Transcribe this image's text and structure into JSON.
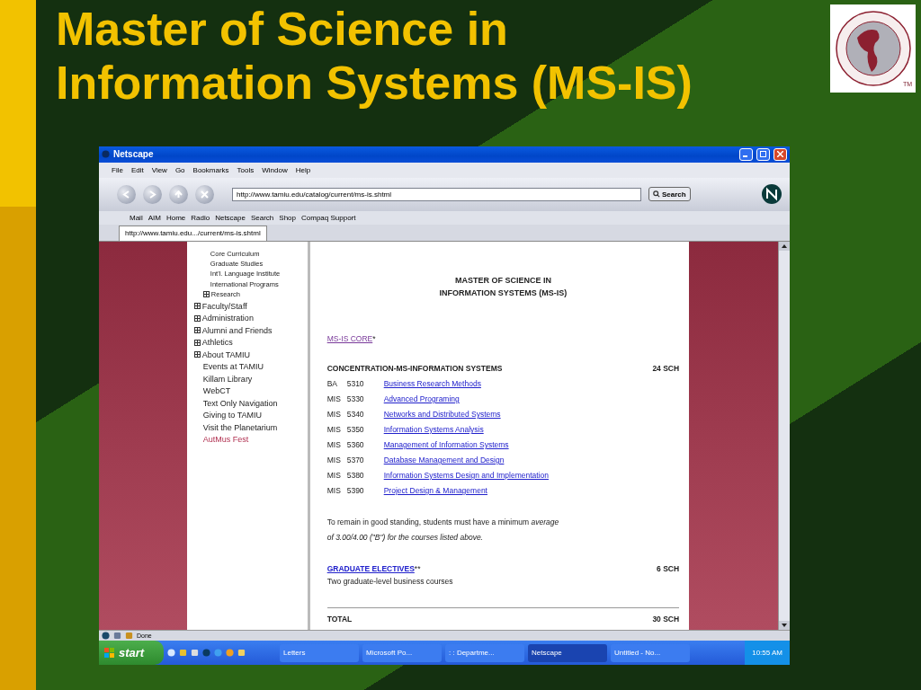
{
  "slide": {
    "title": [
      "Master of Science in",
      "Information Systems (MS-IS)"
    ],
    "logo": {
      "trademark": "TM"
    }
  },
  "browser": {
    "title": "Netscape",
    "menu": [
      "File",
      "Edit",
      "View",
      "Go",
      "Bookmarks",
      "Tools",
      "Window",
      "Help"
    ],
    "address": "http://www.tamiu.edu/catalog/current/ms-is.shtml",
    "search_button": "Search",
    "personal_toolbar": [
      "Mail",
      "AIM",
      "Home",
      "Radio",
      "Netscape",
      "Search",
      "Shop",
      "Compaq Support"
    ],
    "tab": {
      "label": "http://www.tamiu.edu.../current/ms-is.shtml",
      "selected": true
    },
    "nav": [
      {
        "kind": "sub",
        "label": "Core Curriculum"
      },
      {
        "kind": "sub",
        "label": "Graduate Studies"
      },
      {
        "kind": "sub",
        "label": "Int'l. Language Institute"
      },
      {
        "kind": "sub",
        "label": "International Programs"
      },
      {
        "kind": "subgroup",
        "label": "Research",
        "expanded": false
      },
      {
        "kind": "group",
        "label": "Faculty/Staff",
        "expanded": false
      },
      {
        "kind": "group",
        "label": "Administration",
        "expanded": false
      },
      {
        "kind": "group",
        "label": "Alumni and Friends",
        "expanded": false
      },
      {
        "kind": "group",
        "label": "Athletics",
        "expanded": false
      },
      {
        "kind": "group",
        "label": "About TAMIU",
        "expanded": false
      },
      {
        "kind": "link",
        "label": "Events at TAMIU",
        "visited": false
      },
      {
        "kind": "link",
        "label": "Killam Library",
        "visited": false
      },
      {
        "kind": "link",
        "label": "WebCT",
        "visited": false
      },
      {
        "kind": "link",
        "label": "Text Only Navigation",
        "visited": false
      },
      {
        "kind": "link",
        "label": "Giving to TAMIU",
        "visited": false
      },
      {
        "kind": "link",
        "label": "Visit the Planetarium",
        "visited": false
      },
      {
        "kind": "link",
        "label": "AutMus Fest",
        "visited": true
      }
    ],
    "page": {
      "heading": [
        "MASTER OF SCIENCE IN",
        "INFORMATION SYSTEMS (MS-IS)"
      ],
      "core": {
        "link": "MS-IS CORE",
        "suffix": "*"
      },
      "concentration": {
        "title": "CONCENTRATION-MS-INFORMATION SYSTEMS",
        "credits": "24 SCH"
      },
      "courses": [
        {
          "prefix": "BA",
          "number": "5310",
          "title": "Business Research Methods"
        },
        {
          "prefix": "MIS",
          "number": "5330",
          "title": "Advanced Programing"
        },
        {
          "prefix": "MIS",
          "number": "5340",
          "title": "Networks and Distributed Systems"
        },
        {
          "prefix": "MIS",
          "number": "5350",
          "title": "Information Systems Analysis"
        },
        {
          "prefix": "MIS",
          "number": "5360",
          "title": "Management of Information Systems"
        },
        {
          "prefix": "MIS",
          "number": "5370",
          "title": "Database Management and Design"
        },
        {
          "prefix": "MIS",
          "number": "5380",
          "title": "Information Systems Design and Implementation"
        },
        {
          "prefix": "MIS",
          "number": "5390",
          "title": "Project Design & Management"
        }
      ],
      "note": [
        "To remain in good standing, students must have a minimum *average*",
        "*of 3.00/4.00 (\"B\") for the courses listed above.*"
      ],
      "electives": {
        "link": "GRADUATE ELECTIVES",
        "suffix": "**",
        "credits": "6 SCH",
        "description": "Two graduate-level business courses"
      },
      "total": {
        "label": "TOTAL",
        "credits": "30 SCH"
      }
    },
    "status": "Done"
  },
  "taskbar": {
    "start": "start",
    "tasks": [
      {
        "label": "Letters",
        "selected": false
      },
      {
        "label": "Microsoft Po...",
        "selected": false
      },
      {
        "label": ": : Departme...",
        "selected": false
      },
      {
        "label": "Netscape",
        "selected": true
      },
      {
        "label": "Untitled - No...",
        "selected": false
      }
    ],
    "clock": "10:55 AM"
  }
}
